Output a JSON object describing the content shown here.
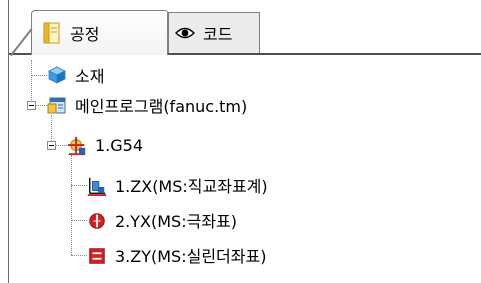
{
  "tabs": [
    {
      "label": "공정",
      "icon": "process-icon",
      "active": true
    },
    {
      "label": "코드",
      "icon": "eye-icon",
      "active": false
    }
  ],
  "tree": {
    "material": {
      "label": "소재",
      "icon": "material-icon"
    },
    "main_program": {
      "label": "메인프로그램(fanuc.tm)",
      "icon": "program-icon",
      "expanded": true
    },
    "coordinate": {
      "label": "1.G54",
      "icon": "coordinate-system-icon",
      "expanded": true
    },
    "children": [
      {
        "label": "1.ZX(MS:직교좌표계)",
        "icon": "cartesian-icon"
      },
      {
        "label": "2.YX(MS:극좌표)",
        "icon": "polar-icon"
      },
      {
        "label": "3.ZY(MS:실린더좌표)",
        "icon": "cylinder-icon"
      }
    ]
  },
  "colors": {
    "accent_red": "#d42020",
    "material_blue": "#3b9be0",
    "tab_border": "#808080"
  }
}
